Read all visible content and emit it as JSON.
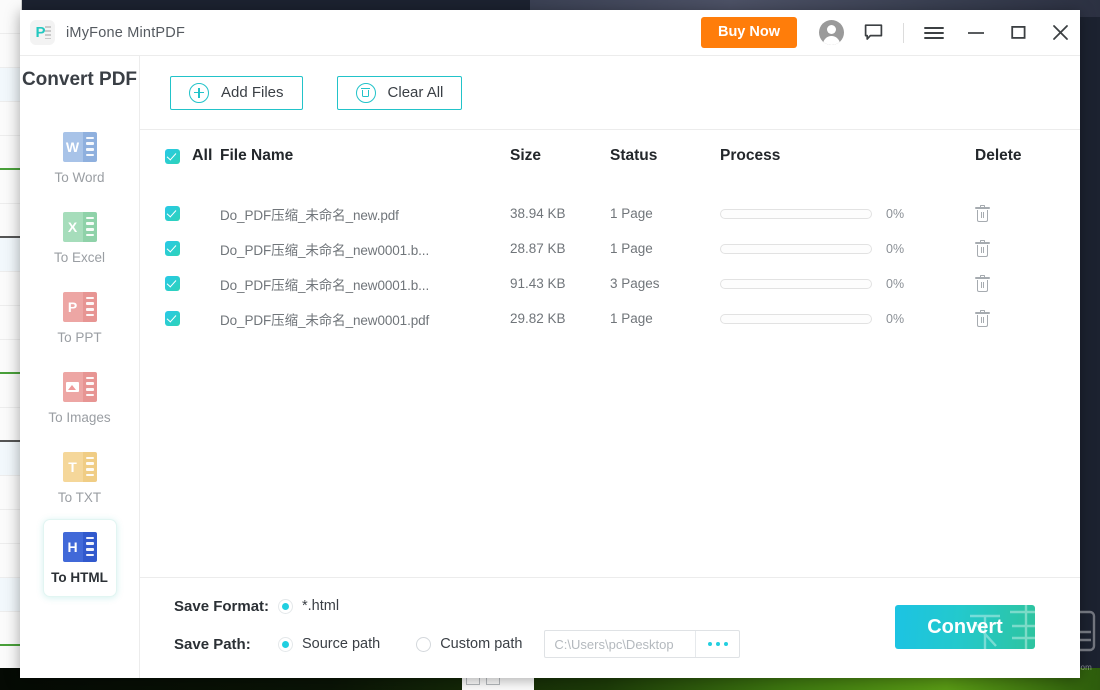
{
  "window": {
    "app_title": "iMyFone MintPDF",
    "logo_letter": "P",
    "buy_now_label": "Buy Now",
    "icons": {
      "account": "account-icon",
      "feedback": "chat-icon",
      "menu": "hamburger-menu-icon",
      "minimize": "minimize-icon",
      "maximize": "maximize-icon",
      "close": "close-icon"
    }
  },
  "sidebar": {
    "title": "Convert PDF",
    "items": [
      {
        "label": "To Word",
        "letter": "W",
        "color": "#a8c3e8",
        "color_dark": "#8fb0de",
        "active": false,
        "icon": "to-word-icon"
      },
      {
        "label": "To Excel",
        "letter": "X",
        "color": "#a6ddbb",
        "color_dark": "#8fd2a9",
        "active": false,
        "icon": "to-excel-icon"
      },
      {
        "label": "To PPT",
        "letter": "P",
        "color": "#eda6a4",
        "color_dark": "#e79593",
        "active": false,
        "icon": "to-ppt-icon"
      },
      {
        "label": "To Images",
        "letter": "",
        "color": "#eda6a4",
        "color_dark": "#e79593",
        "active": false,
        "icon": "to-images-icon"
      },
      {
        "label": "To TXT",
        "letter": "T",
        "color": "#f5d79a",
        "color_dark": "#f0cd85",
        "active": false,
        "icon": "to-txt-icon"
      },
      {
        "label": "To HTML",
        "letter": "H",
        "color": "#4169d8",
        "color_dark": "#3159cd",
        "active": true,
        "icon": "to-html-icon"
      }
    ]
  },
  "toolbar": {
    "add_files_label": "Add Files",
    "clear_all_label": "Clear All"
  },
  "table": {
    "select_all_label": "All",
    "select_all_checked": true,
    "headers": {
      "file_name": "File Name",
      "size": "Size",
      "status": "Status",
      "process": "Process",
      "delete": "Delete"
    },
    "rows": [
      {
        "checked": true,
        "name": "Do_PDF压缩_未命名_new.pdf",
        "size": "38.94 KB",
        "status": "1 Page",
        "percent": "0%",
        "progress": 0
      },
      {
        "checked": true,
        "name": "Do_PDF压缩_未命名_new0001.b...",
        "size": "28.87 KB",
        "status": "1 Page",
        "percent": "0%",
        "progress": 0
      },
      {
        "checked": true,
        "name": "Do_PDF压缩_未命名_new0001.b...",
        "size": "91.43 KB",
        "status": "3 Pages",
        "percent": "0%",
        "progress": 0
      },
      {
        "checked": true,
        "name": "Do_PDF压缩_未命名_new0001.pdf",
        "size": "29.82 KB",
        "status": "1 Page",
        "percent": "0%",
        "progress": 0
      }
    ]
  },
  "footer": {
    "save_format_label": "Save Format:",
    "format_option": "*.html",
    "format_selected": true,
    "save_path_label": "Save Path:",
    "source_path_label": "Source path",
    "source_path_selected": true,
    "custom_path_label": "Custom path",
    "custom_path_selected": false,
    "path_value": "C:\\Users\\pc\\Desktop",
    "browse_icon": "ellipsis-icon",
    "convert_label": "Convert"
  },
  "watermark": {
    "url": "www.xiazaiba.com"
  },
  "colors": {
    "accent": "#22c3c9",
    "accent_cyan": "#21cfe0",
    "accent_green": "#2ec49f",
    "buy_now": "#ff7d0a",
    "text_dark": "#23272b",
    "text_muted": "#70757a"
  }
}
